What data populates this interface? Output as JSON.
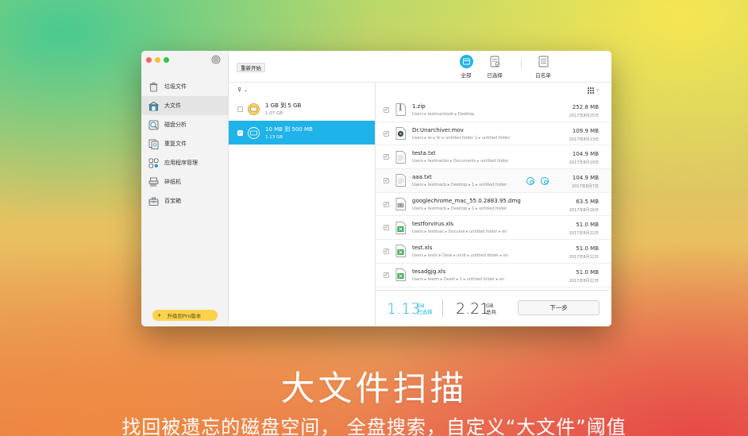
{
  "sidebar": {
    "items": [
      {
        "label": "垃圾文件",
        "icon": "trash-can-icon"
      },
      {
        "label": "大文件",
        "icon": "large-file-box-icon",
        "active": true
      },
      {
        "label": "磁盘分析",
        "icon": "disk-analysis-icon"
      },
      {
        "label": "重复文件",
        "icon": "duplicate-file-icon"
      },
      {
        "label": "应用程序管理",
        "icon": "app-manager-icon"
      },
      {
        "label": "碎纸机",
        "icon": "shredder-icon"
      },
      {
        "label": "百宝箱",
        "icon": "toolbox-icon"
      }
    ],
    "upgrade_label": "升级到Pro版本"
  },
  "toolbar": {
    "restart_label": "重新开始",
    "tabs": [
      {
        "label": "全部",
        "icon": "all-files-icon",
        "active": true
      },
      {
        "label": "已选择",
        "icon": "selected-files-icon"
      },
      {
        "label": "白名单",
        "icon": "whitelist-icon"
      }
    ]
  },
  "ranges": [
    {
      "title": "1 GB 到 5 GB",
      "size": "1.07 GB",
      "checked": false
    },
    {
      "title": "10 MB 到 500 MB",
      "size": "1.13 GB",
      "checked": true
    }
  ],
  "files": [
    {
      "name": "1.zip",
      "path": "Users ▸ testmacbook ▸ Desktop",
      "size": "252.8 MB",
      "date": "2017年8月25日",
      "icon": "zip-file-icon"
    },
    {
      "name": "Dr.Unarchiver.mov",
      "path": "Users ▸ te ▸ Dr ▸ untitled folder 2 ▸ untitled folder",
      "size": "109.9 MB",
      "date": "2017年8月13日",
      "icon": "video-file-icon"
    },
    {
      "name": "testa.txt",
      "path": "Users ▸ testmacbo ▸ Documents ▸ untitled folder",
      "size": "104.9 MB",
      "date": "2017年8月19日",
      "icon": "text-file-icon"
    },
    {
      "name": "aaa.txt",
      "path": "Users ▸ testmacb ▸ Desktop ▸ 1 ▸ untitled folder",
      "size": "104.9 MB",
      "date": "2017年8月7日",
      "icon": "text-file-icon"
    },
    {
      "name": "googlechrome_mac_55.0.2883.95.dmg",
      "path": "Users ▸ testmacb ▸ Desktop ▸ 1 ▸ untitled folder",
      "size": "63.5 MB",
      "date": "2017年8月26日",
      "icon": "dmg-file-icon"
    },
    {
      "name": "testforvirus.xls",
      "path": "Users ▸ testmac ▸ Docume ▸ untitled folder ▸ en",
      "size": "51.0 MB",
      "date": "2017年8月22日",
      "icon": "excel-file-icon"
    },
    {
      "name": "test.xls",
      "path": "Users ▸ testn ▸ Desk ▸ untit ▸ untitled folder ▸ en",
      "size": "51.0 MB",
      "date": "2017年8月22日",
      "icon": "excel-file-icon"
    },
    {
      "name": "tesadgjg.xls",
      "path": "Users ▸ testm ▸ Deskt ▸ 1 ▸ untitled folder ▸ en",
      "size": "51.0 MB",
      "date": "2017年8月22日",
      "icon": "excel-file-icon"
    }
  ],
  "footer": {
    "selected_value": "1.13",
    "selected_unit": "GB",
    "selected_label": "已选择",
    "total_value": "2.21",
    "total_unit": "GB",
    "total_label": "总共",
    "next_label": "下一步"
  },
  "caption": {
    "title": "大文件扫描",
    "subtitle": "找回被遗忘的磁盘空间， 全盘搜索，自定义“大文件”阈值"
  },
  "colors": {
    "accent": "#20b3ea",
    "upgrade": "#fbd34b"
  }
}
